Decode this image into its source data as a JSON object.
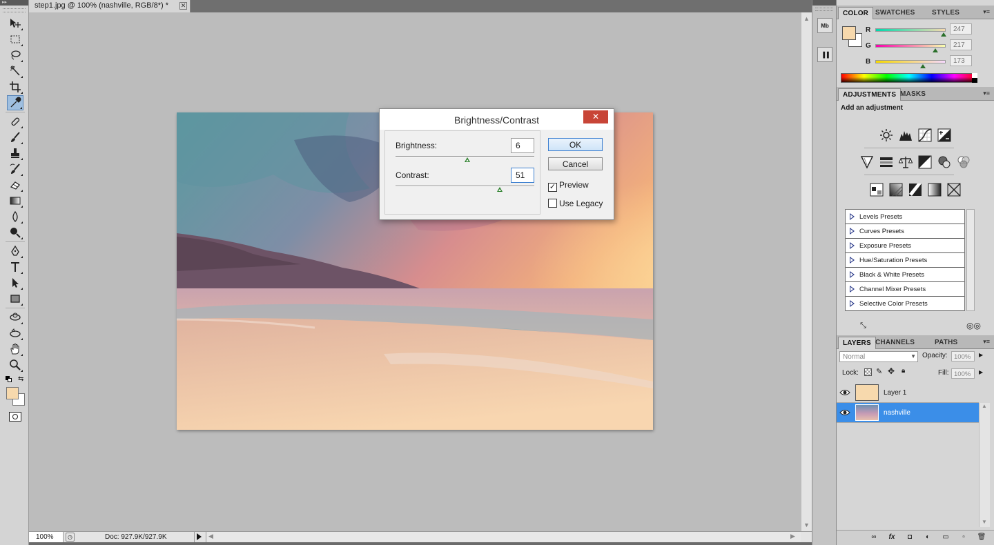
{
  "document": {
    "tab_title": "step1.jpg @ 100% (nashville, RGB/8*) *",
    "close_glyph": "✕"
  },
  "status": {
    "zoom": "100%",
    "doc_info": "Doc: 927.9K/927.9K"
  },
  "color_panel": {
    "tabs": [
      "COLOR",
      "SWATCHES",
      "STYLES"
    ],
    "foreground_color": "#f7d9ad",
    "channels": [
      {
        "label": "R",
        "value": "247",
        "fraction": 0.969
      },
      {
        "label": "G",
        "value": "217",
        "fraction": 0.851
      },
      {
        "label": "B",
        "value": "173",
        "fraction": 0.678
      }
    ]
  },
  "adjustments_panel": {
    "tabs": [
      "ADJUSTMENTS",
      "MASKS"
    ],
    "title": "Add an adjustment",
    "icons_row1": [
      "brightness-contrast-icon",
      "levels-icon",
      "curves-icon",
      "exposure-icon"
    ],
    "icons_row2": [
      "vibrance-icon",
      "hue-saturation-icon",
      "color-balance-icon",
      "black-white-icon",
      "photo-filter-icon",
      "channel-mixer-icon"
    ],
    "icons_row3": [
      "invert-icon",
      "posterize-icon",
      "threshold-icon",
      "gradient-map-icon",
      "selective-color-icon"
    ],
    "presets": [
      "Levels Presets",
      "Curves Presets",
      "Exposure Presets",
      "Hue/Saturation Presets",
      "Black & White Presets",
      "Channel Mixer Presets",
      "Selective Color Presets"
    ]
  },
  "layers_panel": {
    "tabs": [
      "LAYERS",
      "CHANNELS",
      "PATHS"
    ],
    "blend_mode": "Normal",
    "opacity_label": "Opacity:",
    "opacity_value": "100%",
    "lock_label": "Lock:",
    "fill_label": "Fill:",
    "fill_value": "100%",
    "layers": [
      {
        "name": "Layer 1",
        "selected": false
      },
      {
        "name": "nashville",
        "selected": true
      }
    ],
    "footer_icons": [
      "link-layers-icon",
      "fx-icon",
      "add-mask-icon",
      "adjustment-layer-icon",
      "new-group-icon",
      "new-layer-icon",
      "trash-icon"
    ],
    "footer_glyphs": [
      "∞",
      "fx",
      "◘",
      "◐",
      "▭",
      "▫",
      "🗑"
    ]
  },
  "dialog": {
    "title": "Brightness/Contrast",
    "brightness_label": "Brightness:",
    "brightness_value": "6",
    "brightness_fraction": 0.515,
    "contrast_label": "Contrast:",
    "contrast_value": "51",
    "contrast_fraction": 0.75,
    "ok_label": "OK",
    "cancel_label": "Cancel",
    "preview_label": "Preview",
    "preview_checked": true,
    "legacy_label": "Use Legacy",
    "legacy_checked": false
  },
  "dock": {
    "mini_bridge_label": "Mb"
  },
  "tools": [
    "move-tool-icon",
    "marquee-tool-icon",
    "lasso-tool-icon",
    "quick-selection-tool-icon",
    "crop-tool-icon",
    "eyedropper-tool-icon",
    "healing-brush-tool-icon",
    "brush-tool-icon",
    "clone-stamp-tool-icon",
    "history-brush-tool-icon",
    "eraser-tool-icon",
    "gradient-tool-icon",
    "blur-tool-icon",
    "dodge-tool-icon",
    "pen-tool-icon",
    "type-tool-icon",
    "path-selection-tool-icon",
    "shape-tool-icon",
    "3d-rotate-tool-icon",
    "3d-orbit-tool-icon",
    "hand-tool-icon",
    "zoom-tool-icon"
  ]
}
